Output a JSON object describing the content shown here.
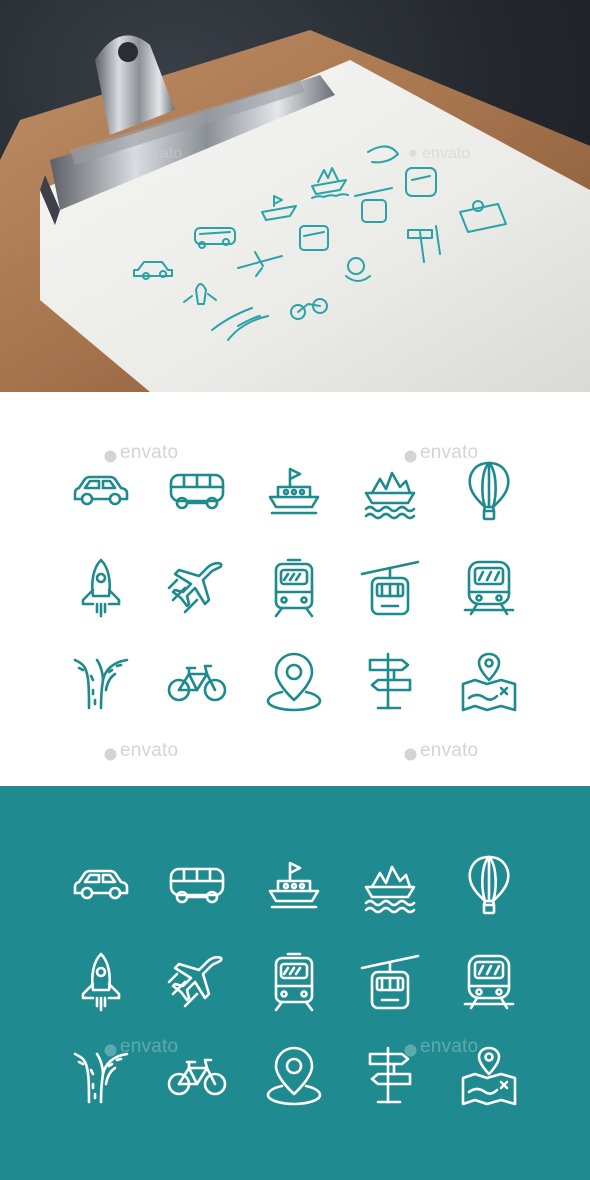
{
  "watermark": {
    "text": "envato"
  },
  "colors": {
    "accent": "#1f8a8f",
    "icon_teal": "#1d8a8e",
    "icon_white": "#ffffff",
    "background_white": "#ffffff"
  },
  "icons": [
    "car-icon",
    "bus-icon",
    "ship-icon",
    "boat-icon",
    "hot-air-balloon-icon",
    "rocket-icon",
    "airplane-icon",
    "tram-icon",
    "cable-car-icon",
    "train-icon",
    "road-icon",
    "bicycle-icon",
    "location-pin-icon",
    "signpost-icon",
    "map-icon"
  ]
}
